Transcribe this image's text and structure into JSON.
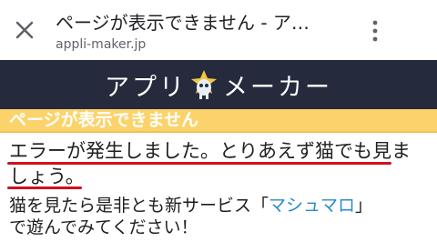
{
  "browser": {
    "title": "ページが表示できません - ア…",
    "url": "appli-maker.jp",
    "close_icon": "close-icon",
    "menu_icon": "more-vert-icon"
  },
  "site": {
    "brand_left": "アプリ",
    "brand_right": "メーカー",
    "logo_icon": "robot-mascot-icon",
    "header_bg": "#252b3d"
  },
  "notice": {
    "text": "ページが表示できません",
    "bg": "#fbd36a"
  },
  "message": {
    "line1": "エラーが発生しました。とりあえず猫でも見ま",
    "line2": "しょう。",
    "underline_color": "#d0111b"
  },
  "invite": {
    "before": "猫を見たら是非とも新サービス「",
    "link": "マシュマロ",
    "after": "」",
    "line2": "で遊んでみてください！",
    "link_color": "#2b8cc8"
  }
}
